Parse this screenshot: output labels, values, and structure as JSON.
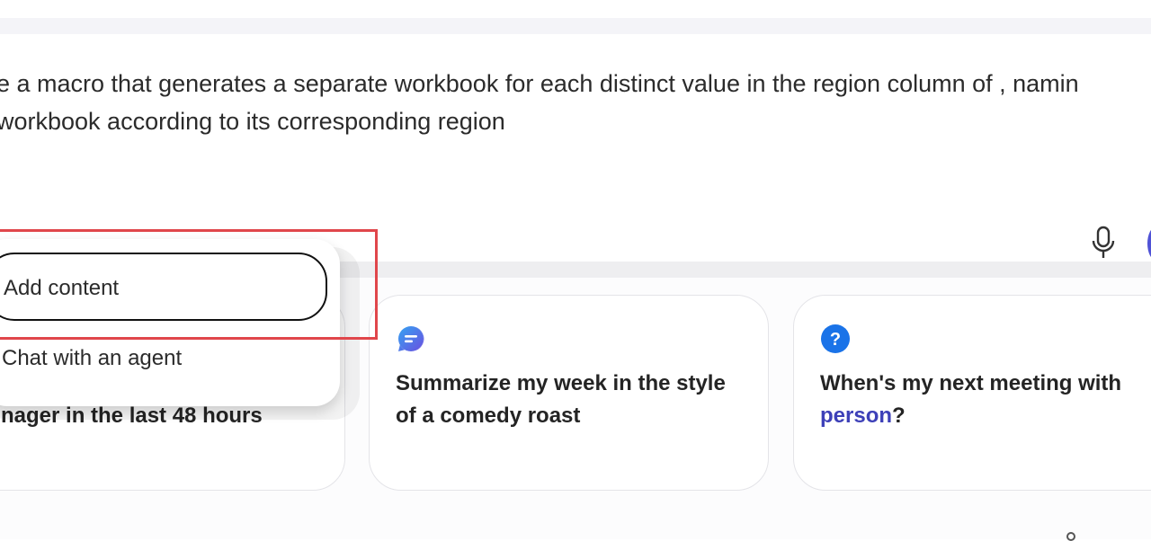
{
  "prompt": {
    "line1": "e a macro that generates a separate workbook for each distinct value in the region column of , namin",
    "line2": "workbook according to its corresponding region"
  },
  "toolbar": {
    "mic_icon": "microphone-icon",
    "send_icon": "send-icon"
  },
  "menu": {
    "items": [
      {
        "label": "Add content"
      },
      {
        "label": "Chat with an agent"
      }
    ]
  },
  "cards": [
    {
      "text": "nager in the last 48 hours"
    },
    {
      "icon": "chat-bubble-icon",
      "text": "Summarize my week in the style of a comedy roast",
      "icon_color": "#3a7ee8"
    },
    {
      "icon": "question-icon",
      "text_before": "When's my next meeting with ",
      "link": "person",
      "text_after": "?",
      "icon_color": "#1a73e8"
    }
  ],
  "colors": {
    "highlight": "#e0464b",
    "link": "#3d40b8",
    "accent": "#4f52d6"
  }
}
